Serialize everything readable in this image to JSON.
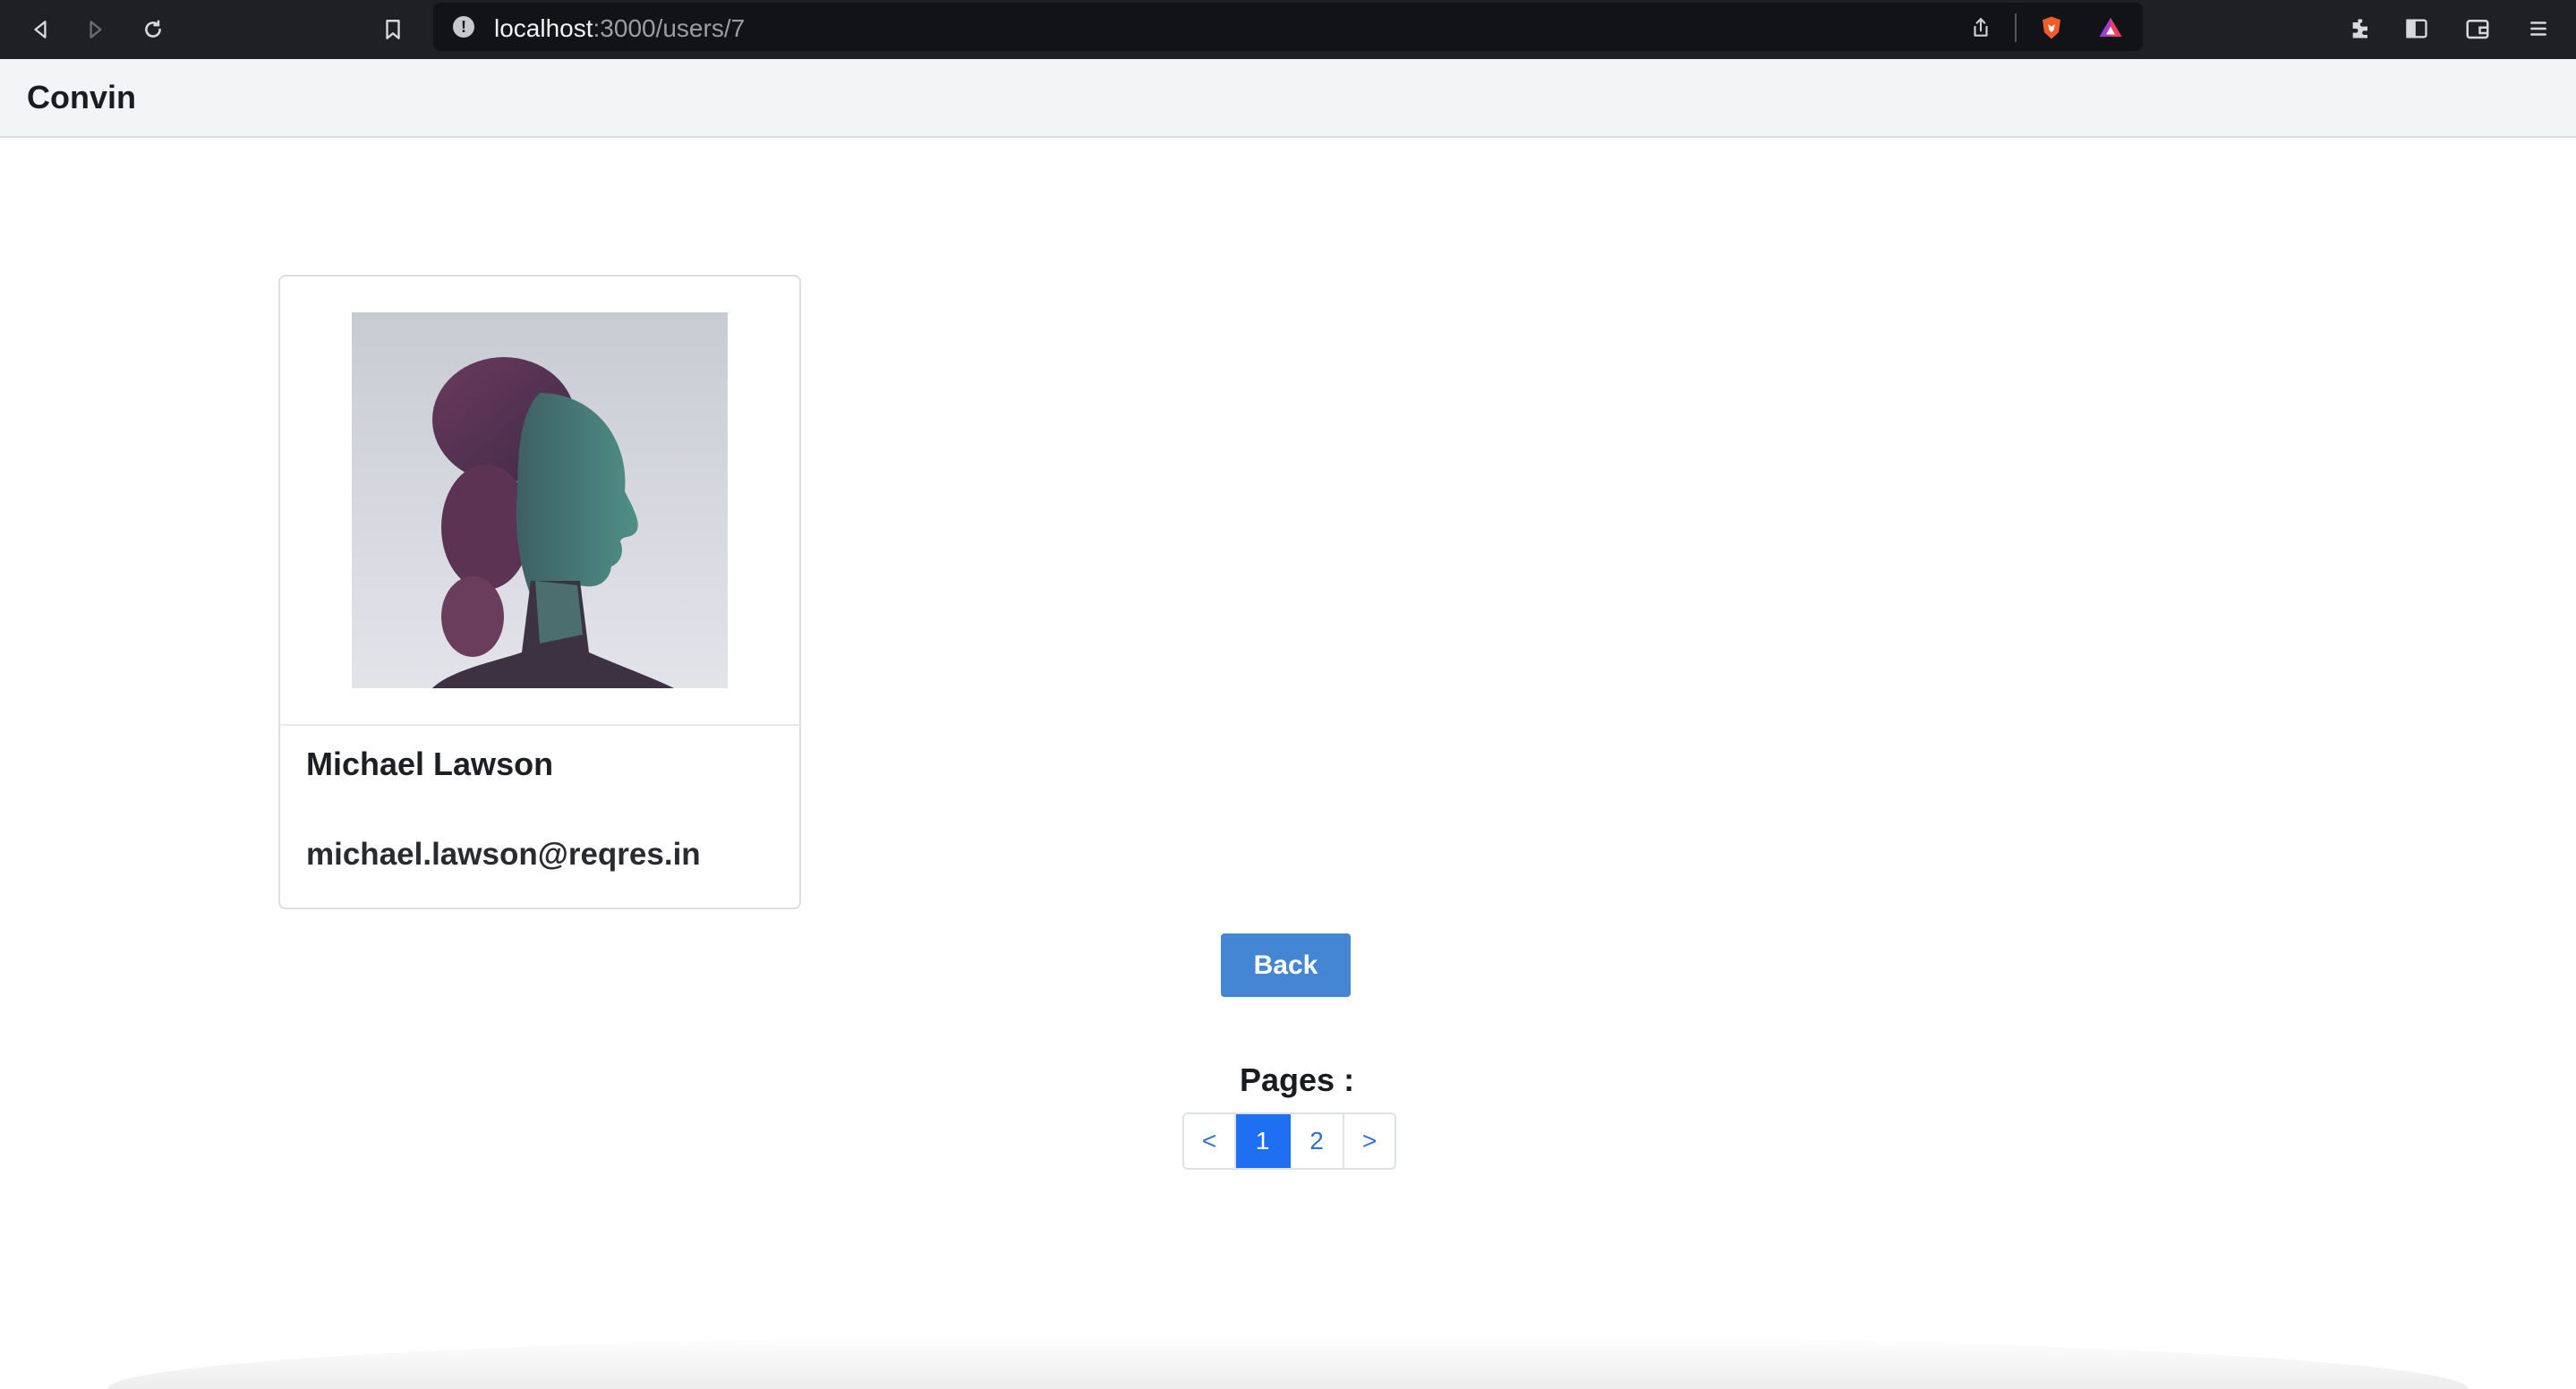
{
  "browser": {
    "url_host": "localhost",
    "url_path": ":3000/users/7"
  },
  "app": {
    "brand": "Convin"
  },
  "user": {
    "name": "Michael Lawson",
    "email": "michael.lawson@reqres.in",
    "avatar_alt": "avatar"
  },
  "actions": {
    "back_label": "Back"
  },
  "pagination": {
    "label": "Pages :",
    "prev_label": "<",
    "pages": [
      "1",
      "2"
    ],
    "current_page": "1",
    "next_label": ">"
  },
  "colors": {
    "accent": "#4486d4",
    "active_page": "#1f6ff2",
    "header_bg": "#f3f4f6"
  }
}
